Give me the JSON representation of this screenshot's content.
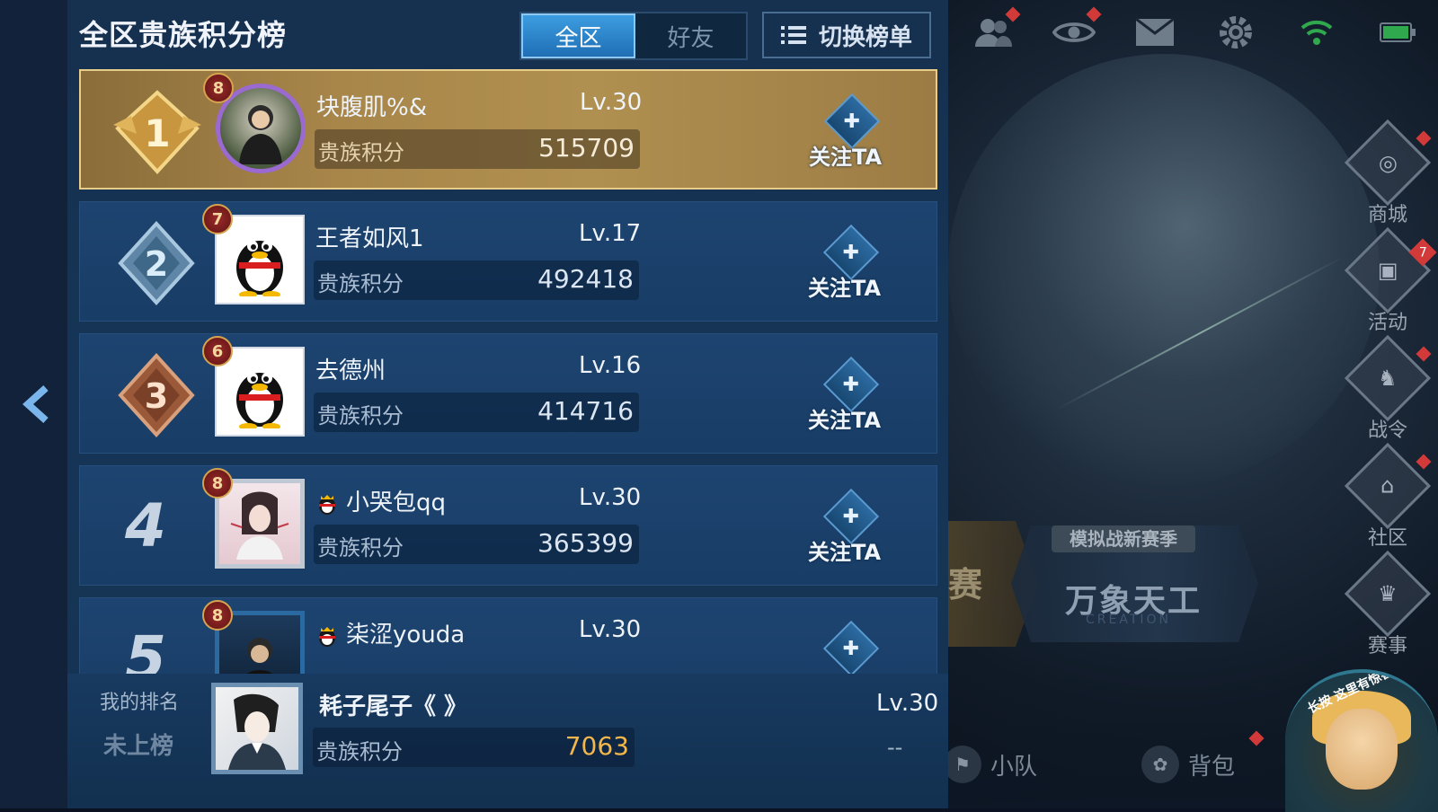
{
  "header": {
    "title": "全区贵族积分榜",
    "tabs": [
      {
        "label": "全区",
        "active": true
      },
      {
        "label": "好友",
        "active": false
      }
    ],
    "switch_button": "切换榜单"
  },
  "rows": [
    {
      "rank": "1",
      "vip": "8",
      "name": "块腹肌%&",
      "level": "Lv.30",
      "score_label": "贵族积分",
      "score": "515709",
      "follow": "关注TA"
    },
    {
      "rank": "2",
      "vip": "7",
      "name": "王者如风1",
      "level": "Lv.17",
      "score_label": "贵族积分",
      "score": "492418",
      "follow": "关注TA"
    },
    {
      "rank": "3",
      "vip": "6",
      "name": "去德州",
      "level": "Lv.16",
      "score_label": "贵族积分",
      "score": "414716",
      "follow": "关注TA"
    },
    {
      "rank": "4",
      "vip": "8",
      "name": "小哭包qq",
      "level": "Lv.30",
      "score_label": "贵族积分",
      "score": "365399",
      "follow": "关注TA"
    },
    {
      "rank": "5",
      "vip": "8",
      "name": "柒涩youda",
      "level": "Lv.30"
    }
  ],
  "my_rank": {
    "label": "我的排名",
    "status": "未上榜",
    "name": "耗子尾子《 》",
    "level": "Lv.30",
    "score_label": "贵族积分",
    "score": "7063",
    "rank_placeholder": "--"
  },
  "side_menu": [
    {
      "label": "商城",
      "icon": "shop-icon"
    },
    {
      "label": "活动",
      "icon": "event-icon",
      "badge": "7"
    },
    {
      "label": "战令",
      "icon": "battle-pass-icon"
    },
    {
      "label": "社区",
      "icon": "community-icon"
    },
    {
      "label": "赛事",
      "icon": "trophy-icon"
    }
  ],
  "banner": {
    "mode_text": "赛",
    "season_tag": "模拟战新赛季",
    "season_title": "万象天工",
    "season_sub": "CREATION"
  },
  "bottom_nav": [
    {
      "label": "小队"
    },
    {
      "label": "背包"
    }
  ],
  "character_caption": "长按 这里有惊喜哦",
  "colors": {
    "panel": "#163556",
    "gold_row": "#a8864a",
    "tab_active": "#2a86cc",
    "my_score": "#f2b64a"
  }
}
